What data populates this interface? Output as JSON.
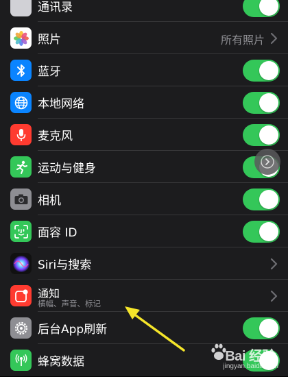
{
  "settings": {
    "contacts": {
      "label": "通讯录"
    },
    "photos": {
      "label": "照片",
      "value": "所有照片"
    },
    "bluetooth": {
      "label": "蓝牙"
    },
    "local_network": {
      "label": "本地网络"
    },
    "microphone": {
      "label": "麦克风"
    },
    "motion_fitness": {
      "label": "运动与健身"
    },
    "camera": {
      "label": "相机"
    },
    "face_id": {
      "label": "面容 ID"
    },
    "siri_search": {
      "label": "Siri与搜索"
    },
    "notifications": {
      "label": "通知",
      "sublabel": "横幅、声音、标记"
    },
    "background_refresh": {
      "label": "后台App刷新"
    },
    "cellular": {
      "label": "蜂窝数据"
    }
  },
  "icons": {
    "photos": "flower-icon",
    "bluetooth": "bluetooth-icon",
    "local_network": "globe-icon",
    "microphone": "microphone-icon",
    "motion_fitness": "running-figure-icon",
    "camera": "camera-icon",
    "face_id": "face-id-icon",
    "siri_search": "siri-orb-icon",
    "notifications": "notification-icon",
    "background_refresh": "gear-icon",
    "cellular": "antenna-icon"
  },
  "colors": {
    "toggle_on": "#34c759",
    "bluetooth": "#0a84ff",
    "network": "#0a84ff",
    "microphone": "#ff3b30",
    "motion": "#34c759",
    "camera": "#8e8e93",
    "face_id": "#34c759",
    "notifications": "#ff3b30",
    "background_refresh": "#8e8e93",
    "cellular": "#34c759",
    "arrow": "#f5e52a"
  },
  "toggles": {
    "contacts": true,
    "bluetooth": true,
    "local_network": true,
    "microphone": true,
    "motion_fitness": true,
    "camera": true,
    "face_id": true,
    "background_refresh": true,
    "cellular": true
  },
  "watermark": {
    "brand": "Bai 经验",
    "url": "jingyan.baidu.com"
  }
}
